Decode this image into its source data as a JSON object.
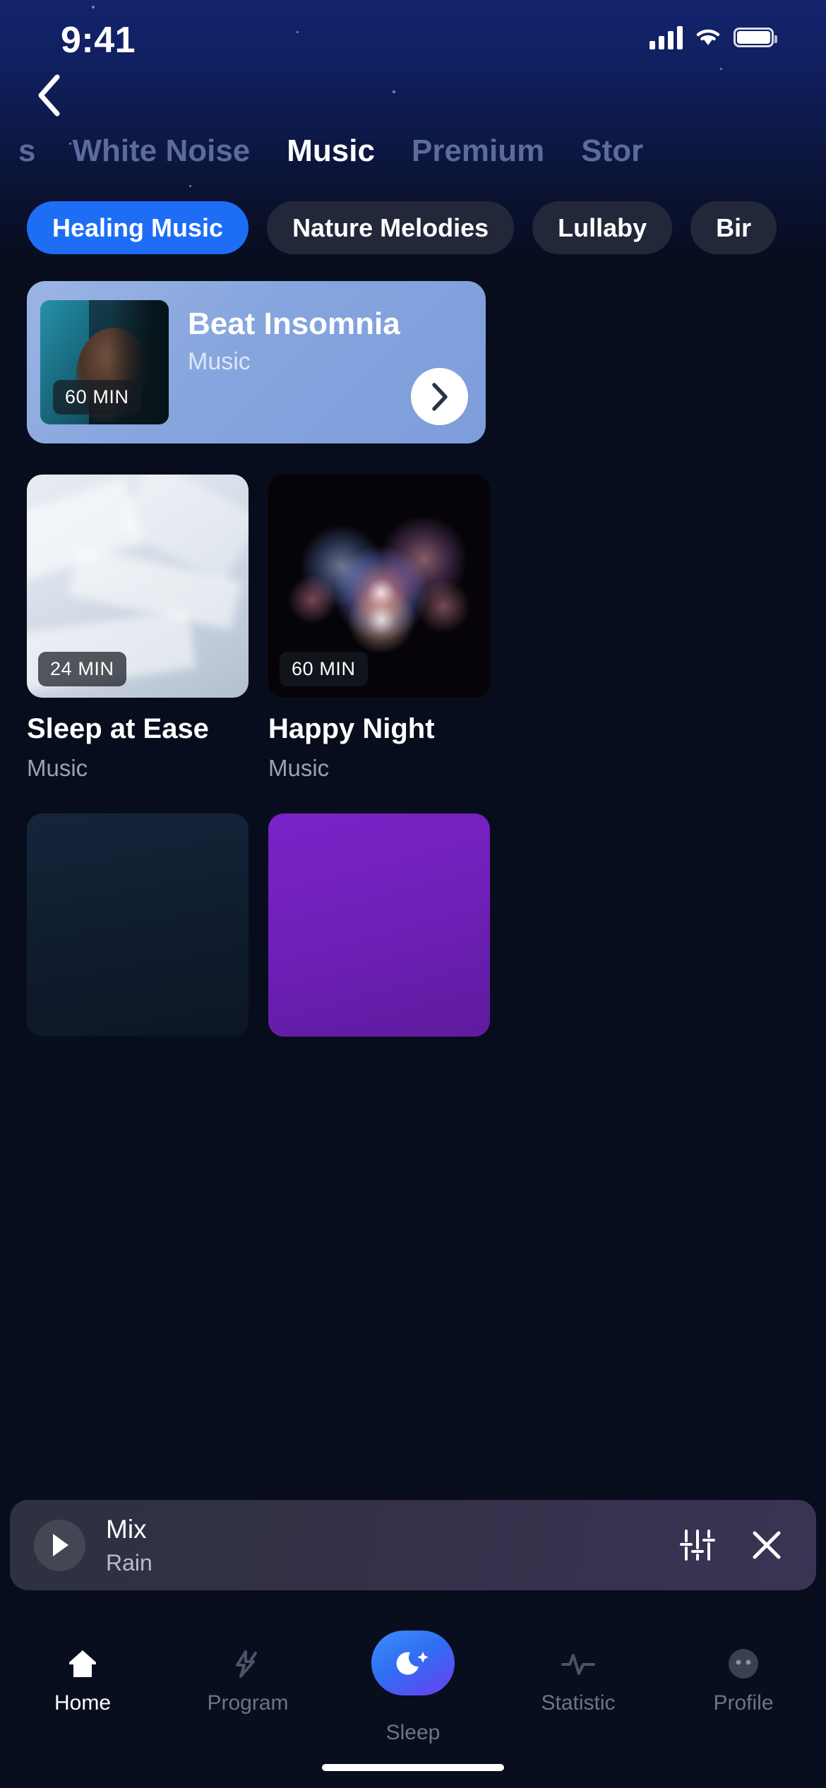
{
  "status_bar": {
    "time": "9:41",
    "signal_icon": "cellular-signal-icon",
    "wifi_icon": "wifi-icon",
    "battery_icon": "battery-icon"
  },
  "header": {
    "back_icon": "chevron-left-icon",
    "accent_color": "#1d6ef5",
    "background_color": "#13246e"
  },
  "tabs": [
    {
      "label": "s",
      "active": false
    },
    {
      "label": "White Noise",
      "active": false
    },
    {
      "label": "Music",
      "active": true
    },
    {
      "label": "Premium",
      "active": false
    },
    {
      "label": "Stor",
      "active": false
    }
  ],
  "chips": [
    {
      "label": "Healing Music",
      "active": true
    },
    {
      "label": "Nature Melodies",
      "active": false
    },
    {
      "label": "Lullaby",
      "active": false
    },
    {
      "label": "Bir",
      "active": false
    }
  ],
  "featured": {
    "title": "Beat Insomnia",
    "subtitle": "Music",
    "duration": "60 MIN",
    "arrow_icon": "chevron-right-icon",
    "background_color": "#8aa8e0"
  },
  "grid": [
    {
      "title": "Sleep at Ease",
      "subtitle": "Music",
      "duration": "24 MIN",
      "image": "feather-texture"
    },
    {
      "title": "Happy Night",
      "subtitle": "Music",
      "duration": "60 MIN",
      "image": "fireworks"
    }
  ],
  "grid_row2": [
    {
      "image": "night-sky"
    },
    {
      "image": "purple-gradient"
    }
  ],
  "mini_player": {
    "play_icon": "play-icon",
    "title": "Mix",
    "subtitle": "Rain",
    "equalizer_icon": "equalizer-sliders-icon",
    "close_icon": "close-x-icon"
  },
  "bottom_nav": [
    {
      "label": "Home",
      "icon": "home-icon",
      "active": true
    },
    {
      "label": "Program",
      "icon": "program-icon",
      "active": false
    },
    {
      "label": "Sleep",
      "icon": "moon-star-icon",
      "active": false
    },
    {
      "label": "Statistic",
      "icon": "pulse-icon",
      "active": false
    },
    {
      "label": "Profile",
      "icon": "profile-avatar-icon",
      "active": false
    }
  ]
}
